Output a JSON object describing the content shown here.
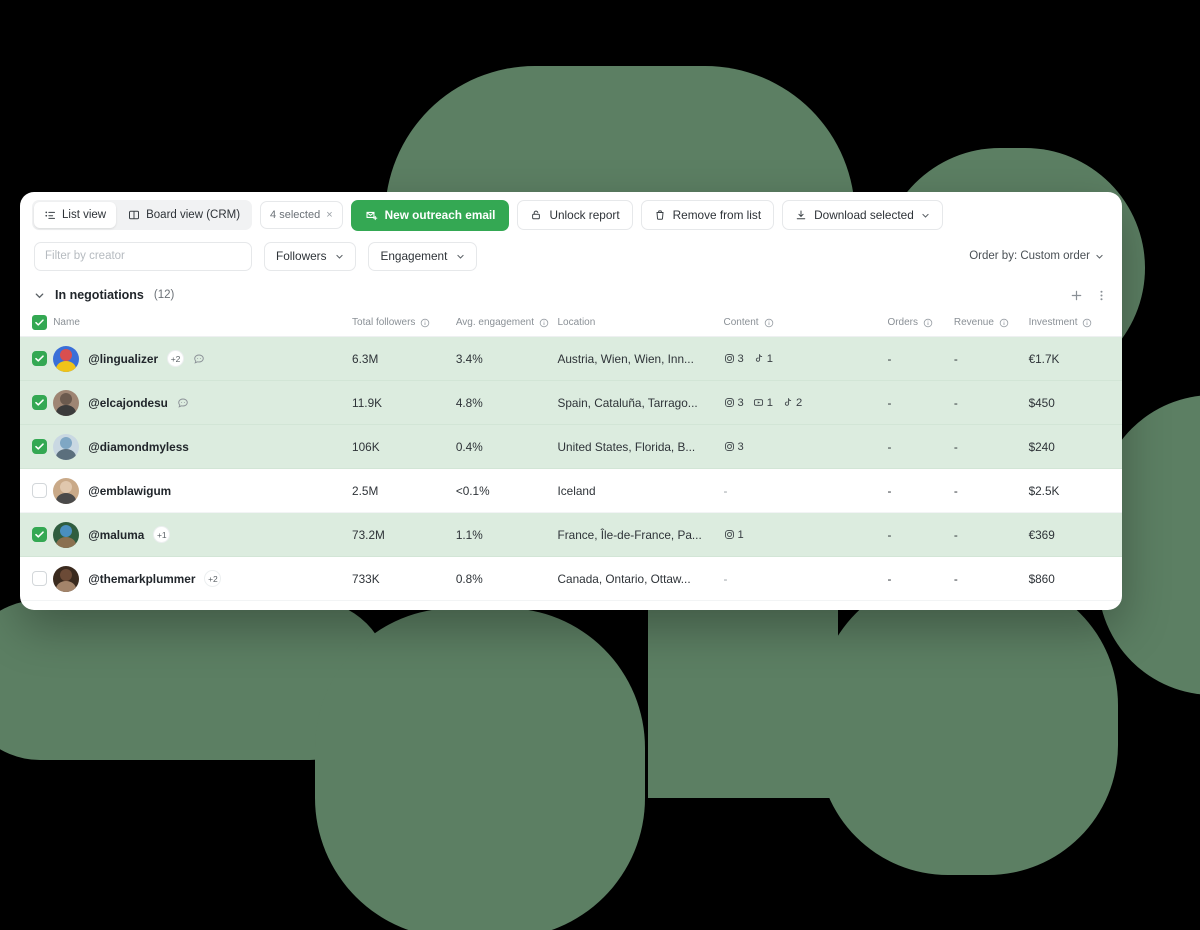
{
  "theme": {
    "background": "#000000",
    "blob_color": "#5c7f63",
    "card_background": "#ffffff",
    "accent_green": "#34a853",
    "selected_row_background": "#dcecdf",
    "muted_text": "#8a9096"
  },
  "toolbar": {
    "views": [
      {
        "label": "List view",
        "icon": "list-view-icon",
        "active": true
      },
      {
        "label": "Board view (CRM)",
        "icon": "board-view-icon",
        "active": false
      }
    ],
    "selection_chip": {
      "label": "4 selected",
      "clear": "×"
    },
    "actions": [
      {
        "label": "New outreach email",
        "icon": "new-email-icon",
        "primary": true
      },
      {
        "label": "Unlock report",
        "icon": "lock-icon",
        "primary": false
      },
      {
        "label": "Remove from list",
        "icon": "trash-icon",
        "primary": false
      },
      {
        "label": "Download selected",
        "icon": "download-icon",
        "primary": false,
        "caret": true
      }
    ]
  },
  "filters": {
    "search_placeholder": "Filter by creator",
    "search_value": "",
    "followers_label": "Followers",
    "engagement_label": "Engagement",
    "order_by_label": "Order by: Custom order"
  },
  "group": {
    "title": "In negotiations",
    "count": "(12)",
    "collapse_icon": "chevron-down-icon",
    "add_icon": "plus-icon",
    "more_icon": "more-vertical-icon"
  },
  "table": {
    "columns": [
      {
        "key": "check",
        "label": "",
        "info": false
      },
      {
        "key": "name",
        "label": "Name",
        "info": false
      },
      {
        "key": "followers",
        "label": "Total followers",
        "info": true
      },
      {
        "key": "engagement",
        "label": "Avg. engagement",
        "info": true
      },
      {
        "key": "location",
        "label": "Location",
        "info": false
      },
      {
        "key": "content",
        "label": "Content",
        "info": true
      },
      {
        "key": "orders",
        "label": "Orders",
        "info": true
      },
      {
        "key": "revenue",
        "label": "Revenue",
        "info": true
      },
      {
        "key": "investment",
        "label": "Investment",
        "info": true
      }
    ],
    "rows": [
      {
        "selected": true,
        "handle": "@lingualizer",
        "plus": "+2",
        "comment_icon": true,
        "avatar_colors": [
          "#d94f4f",
          "#3a6fd8",
          "#f0c419"
        ],
        "followers": "6.3M",
        "engagement": "3.4%",
        "location": "Austria, Wien, Wien, Inn...",
        "content": [
          {
            "platform": "instagram",
            "count": "3"
          },
          {
            "platform": "tiktok",
            "count": "1"
          }
        ],
        "orders": "-",
        "revenue": "-",
        "investment": "€1.7K"
      },
      {
        "selected": true,
        "handle": "@elcajondesu",
        "plus": "",
        "comment_icon": true,
        "avatar_colors": [
          "#6b5a4e",
          "#9e8573",
          "#3b3b3b"
        ],
        "followers": "11.9K",
        "engagement": "4.8%",
        "location": "Spain, Cataluña, Tarrago...",
        "content": [
          {
            "platform": "instagram",
            "count": "3"
          },
          {
            "platform": "youtube",
            "count": "1"
          },
          {
            "platform": "tiktok",
            "count": "2"
          }
        ],
        "orders": "-",
        "revenue": "-",
        "investment": "$450"
      },
      {
        "selected": true,
        "handle": "@diamondmyless",
        "plus": "",
        "comment_icon": false,
        "avatar_colors": [
          "#7fa7c4",
          "#c9d8e2",
          "#5b6f7d"
        ],
        "followers": "106K",
        "engagement": "0.4%",
        "location": "United States, Florida, B...",
        "content": [
          {
            "platform": "instagram",
            "count": "3"
          }
        ],
        "orders": "-",
        "revenue": "-",
        "investment": "$240"
      },
      {
        "selected": false,
        "handle": "@emblawigum",
        "plus": "",
        "comment_icon": false,
        "avatar_colors": [
          "#e0c7ad",
          "#c9a988",
          "#4a4a4a"
        ],
        "followers": "2.5M",
        "engagement": "<0.1%",
        "location": "Iceland",
        "content": [],
        "orders": "-",
        "revenue": "-",
        "investment": "$2.5K"
      },
      {
        "selected": true,
        "handle": "@maluma",
        "plus": "+1",
        "comment_icon": false,
        "avatar_colors": [
          "#4a8fbf",
          "#2f5d3f",
          "#8a7050"
        ],
        "followers": "73.2M",
        "engagement": "1.1%",
        "location": "France, Île-de-France, Pa...",
        "content": [
          {
            "platform": "instagram",
            "count": "1"
          }
        ],
        "orders": "-",
        "revenue": "-",
        "investment": "€369"
      },
      {
        "selected": false,
        "handle": "@themarkplummer",
        "plus": "+2",
        "comment_icon": false,
        "avatar_colors": [
          "#6b4a36",
          "#3a2a1e",
          "#a3846a"
        ],
        "followers": "733K",
        "engagement": "0.8%",
        "location": "Canada, Ontario, Ottaw...",
        "content": [],
        "orders": "-",
        "revenue": "-",
        "investment": "$860"
      }
    ]
  }
}
